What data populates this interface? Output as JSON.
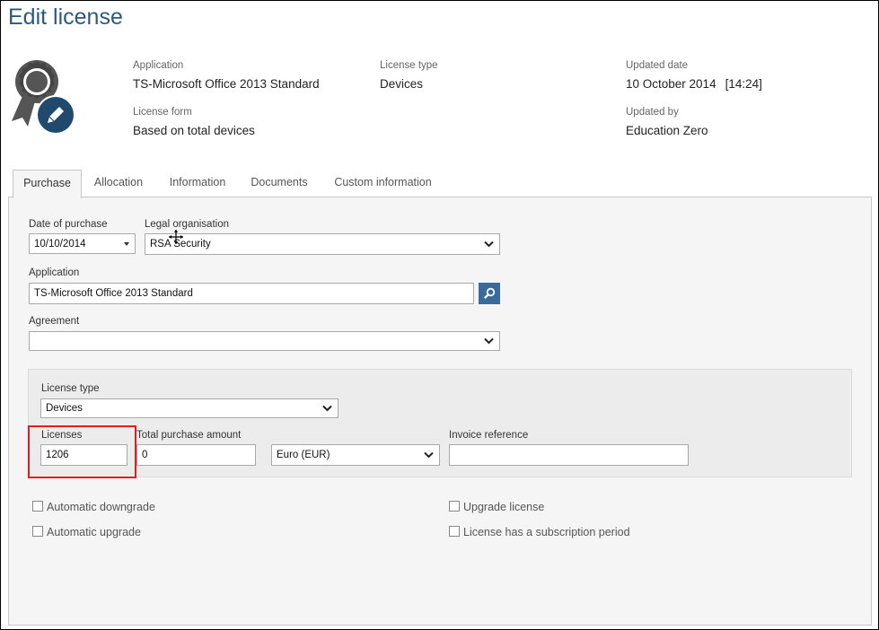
{
  "page": {
    "title": "Edit license"
  },
  "icons": {
    "badge": "award-ribbon-icon",
    "edit": "pencil-icon",
    "search": "search-icon",
    "dropdown": "chevron-down-icon"
  },
  "summary": {
    "application_label": "Application",
    "application_value": "TS-Microsoft Office 2013 Standard",
    "license_form_label": "License form",
    "license_form_value": "Based on total devices",
    "license_type_label": "License type",
    "license_type_value": "Devices",
    "updated_date_label": "Updated date",
    "updated_date_value": "10 October 2014",
    "updated_time_value": "[14:24]",
    "updated_by_label": "Updated by",
    "updated_by_value": "Education Zero"
  },
  "tabs": [
    {
      "label": "Purchase",
      "active": true
    },
    {
      "label": "Allocation",
      "active": false
    },
    {
      "label": "Information",
      "active": false
    },
    {
      "label": "Documents",
      "active": false
    },
    {
      "label": "Custom information",
      "active": false
    }
  ],
  "form": {
    "date_of_purchase_label": "Date of purchase",
    "date_of_purchase_value": "10/10/2014",
    "legal_org_label": "Legal organisation",
    "legal_org_value": "RSA Security",
    "application_label": "Application",
    "application_value": "TS-Microsoft Office 2013 Standard",
    "agreement_label": "Agreement",
    "agreement_value": "",
    "license_type_label": "License type",
    "license_type_value": "Devices",
    "licenses_label": "Licenses",
    "licenses_value": "1206",
    "total_purchase_label": "Total purchase amount",
    "total_purchase_value": "0",
    "currency_value": "Euro (EUR)",
    "invoice_ref_label": "Invoice reference",
    "invoice_ref_value": ""
  },
  "checkboxes": {
    "auto_downgrade": {
      "label": "Automatic downgrade",
      "checked": false
    },
    "auto_upgrade": {
      "label": "Automatic upgrade",
      "checked": false
    },
    "upgrade_license": {
      "label": "Upgrade license",
      "checked": false
    },
    "subscription": {
      "label": "License has a subscription period",
      "checked": false
    }
  },
  "colors": {
    "title": "#2b5a7e",
    "badge_circle": "#1f4a6e",
    "search_button": "#3a6a9b",
    "highlight": "#e02020"
  }
}
